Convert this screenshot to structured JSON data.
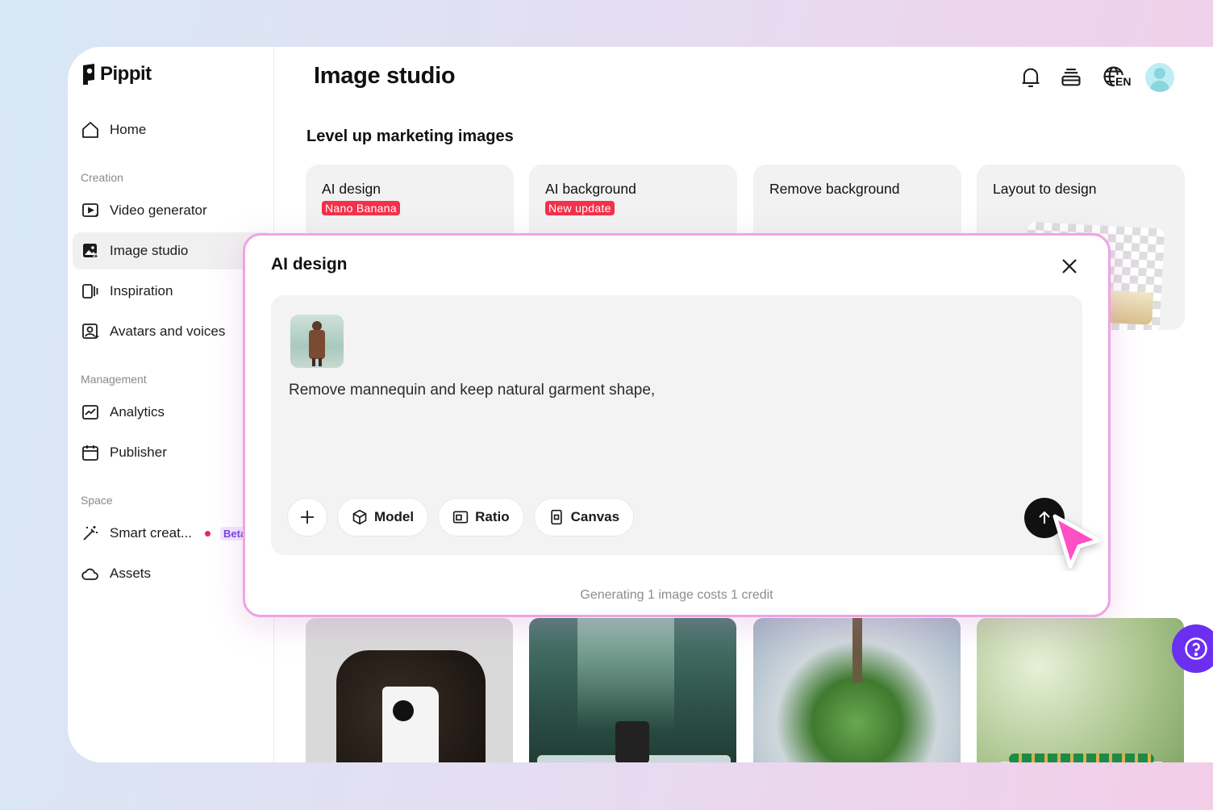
{
  "app": {
    "name": "Pippit"
  },
  "sidebar": {
    "home": "Home",
    "sections": {
      "creation": "Creation",
      "management": "Management",
      "space": "Space"
    },
    "items": {
      "video_generator": "Video generator",
      "image_studio": "Image studio",
      "inspiration": "Inspiration",
      "avatars_voices": "Avatars and voices",
      "analytics": "Analytics",
      "publisher": "Publisher",
      "smart_creation": "Smart creat...",
      "smart_creation_badge": "Beta",
      "assets": "Assets"
    }
  },
  "header": {
    "title": "Image studio",
    "language": "EN"
  },
  "main": {
    "section_title": "Level up marketing images",
    "cards": [
      {
        "title": "AI design",
        "badge": "Nano Banana"
      },
      {
        "title": "AI background",
        "badge": "New update"
      },
      {
        "title": "Remove background"
      },
      {
        "title": "Layout to design"
      }
    ]
  },
  "modal": {
    "title": "AI design",
    "prompt": "Remove mannequin and keep natural garment shape,",
    "tools": {
      "model": "Model",
      "ratio": "Ratio",
      "canvas": "Canvas"
    },
    "cost_note": "Generating 1 image costs 1 credit"
  },
  "colors": {
    "accent": "#6b2ff0",
    "badge_red": "#f2314b",
    "modal_border": "#f1a3e3",
    "cursor_pink": "#ff4fc4"
  }
}
